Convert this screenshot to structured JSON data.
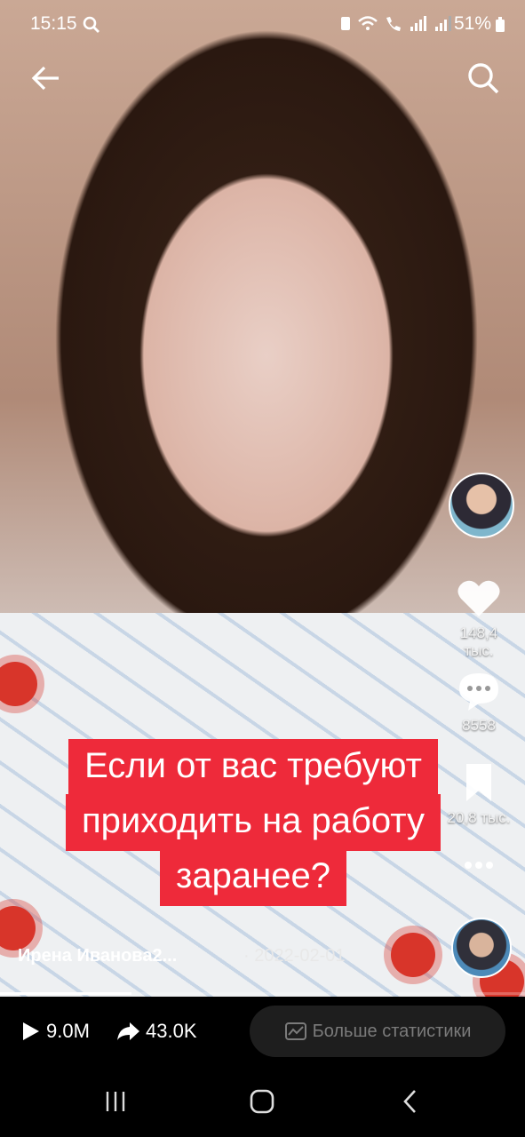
{
  "status_bar": {
    "time": "15:15",
    "battery": "51%"
  },
  "caption": {
    "lines": [
      "Если от вас требуют",
      "приходить на работу",
      "заранее?"
    ]
  },
  "actions": {
    "likes": "148,4 тыс.",
    "comments": "8558",
    "saves": "20,8 тыс."
  },
  "video": {
    "author": "Ирена Иванова2...",
    "date": "· 2022-02-01",
    "progress": 0.25
  },
  "stats": {
    "plays": "9.0M",
    "shares": "43.0K",
    "more_stats_label": "Больше статистики"
  },
  "colors": {
    "caption_bg": "#ee2a3a",
    "background": "#000000"
  }
}
